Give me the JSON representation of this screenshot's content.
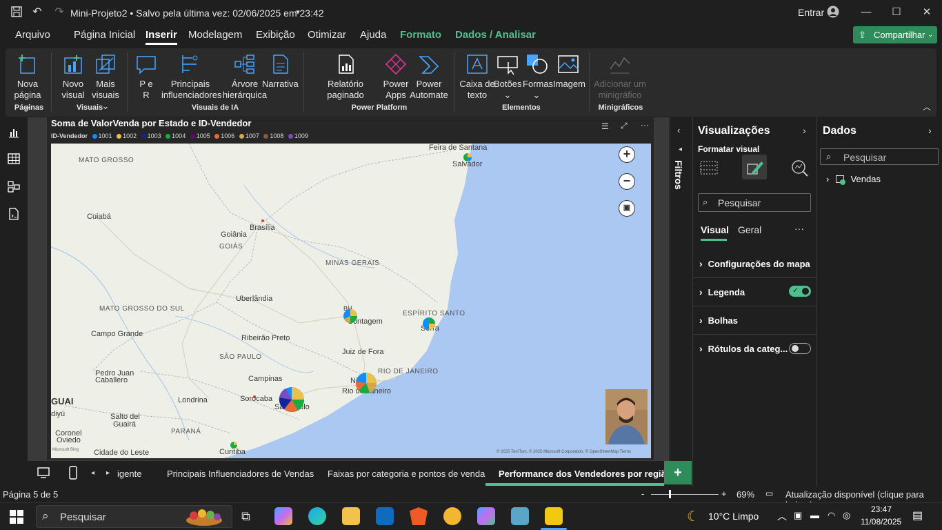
{
  "titlebar": {
    "doc_title": "Mini-Projeto2 • Salvo pela última vez: 02/06/2025 em 23:42",
    "signin": "Entrar"
  },
  "menu": {
    "items": [
      "Arquivo",
      "Página Inicial",
      "Inserir",
      "Modelagem",
      "Exibição",
      "Otimizar",
      "Ajuda",
      "Formato",
      "Dados / Analisar"
    ],
    "share": "Compartilhar"
  },
  "ribbon": {
    "new_page_1": "Nova",
    "new_page_2": "página ⌄",
    "new_visual_1": "Novo",
    "new_visual_2": "visual",
    "more_visuals_1": "Mais",
    "more_visuals_2": "visuais ⌄",
    "qa_1": "P e",
    "qa_2": "R",
    "influencers_1": "Principais",
    "influencers_2": "influenciadores",
    "tree_1": "Árvore",
    "tree_2": "hierárquica",
    "narrative": "Narrativa",
    "paginated": "Relatório paginado",
    "power_apps_1": "Power",
    "power_apps_2": "Apps",
    "power_automate_1": "Power",
    "power_automate_2": "Automate",
    "textbox_1": "Caixa de",
    "textbox_2": "texto",
    "buttons_1": "Botões",
    "buttons_2": "⌄",
    "shapes_1": "Formas",
    "shapes_2": "⌄",
    "image": "Imagem",
    "sparkline_1": "Adicionar um",
    "sparkline_2": "minigráfico",
    "groups": {
      "pages": "Páginas",
      "visuals": "Visuais",
      "ai_visuals": "Visuais de IA",
      "power_platform": "Power Platform",
      "elements": "Elementos",
      "sparklines": "Minigráficos"
    }
  },
  "visual": {
    "title": "Soma de ValorVenda por Estado e ID-Vendedor",
    "legend_title": "ID-Vendedor",
    "legend": [
      {
        "label": "1001",
        "color": "#118dff"
      },
      {
        "label": "1002",
        "color": "#e8c14e"
      },
      {
        "label": "1003",
        "color": "#12239e"
      },
      {
        "label": "1004",
        "color": "#1aab40"
      },
      {
        "label": "1005",
        "color": "#6b007b"
      },
      {
        "label": "1006",
        "color": "#e66c37"
      },
      {
        "label": "1007",
        "color": "#d6a64b"
      },
      {
        "label": "1008",
        "color": "#8a5a3c"
      },
      {
        "label": "1009",
        "color": "#744ec2"
      }
    ]
  },
  "map": {
    "places": {
      "feira": "Feira de Santana",
      "salvador": "Salvador",
      "mato_grosso": "MATO GROSSO",
      "cuiaba": "Cuiabá",
      "brasilia": "Brasília",
      "goiania": "Goiânia",
      "goias": "GOIÁS",
      "minas": "MINAS GERAIS",
      "uberlandia": "Uberlândia",
      "ms": "MATO GROSSO DO SUL",
      "bh": "BH",
      "contagem": "Contagem",
      "es": "ESPÍRITO SANTO",
      "serra": "Serra",
      "campo_grande": "Campo Grande",
      "ribeirao": "Ribeirão Preto",
      "sp_state": "SÃO PAULO",
      "juiz": "Juiz de Fora",
      "rj_state": "RIO DE JANEIRO",
      "pedro_juan": "Pedro Juan",
      "caballero": "Caballero",
      "campinas": "Campinas",
      "nit": "Niterói",
      "rio": "Rio de Janeiro",
      "guai": "GUAI",
      "londrina": "Londrina",
      "sorocaba": "Sorocaba",
      "saopaulo": "São Paulo",
      "diyu": "diyú",
      "salto": "Salto del",
      "guaira": "Guairá",
      "parana": "PARANÁ",
      "coronel": "Coronel",
      "oviedo": "Oviedo",
      "curitiba": "Curitiba",
      "cidade_leste": "Cidade do Leste",
      "bing": "Microsoft Bing"
    },
    "credit": "© 2025 TomTom, © 2025 Microsoft Corporation, © OpenStreetMap  Terms"
  },
  "filters": {
    "label": "Filtros"
  },
  "vispane": {
    "title": "Visualizações",
    "subtitle": "Formatar visual",
    "search_placeholder": "Pesquisar",
    "tab_visual": "Visual",
    "tab_geral": "Geral",
    "more": "···",
    "sections": [
      {
        "label": "Configurações do mapa"
      },
      {
        "label": "Legenda",
        "toggle": true
      },
      {
        "label": "Bolhas"
      },
      {
        "label": "Rótulos da categ...",
        "toggle": false
      }
    ]
  },
  "dados": {
    "title": "Dados",
    "search_placeholder": "Pesquisar",
    "table": "Vendas"
  },
  "pages": {
    "tabs": [
      "igente",
      "Principais Influenciadores de Vendas",
      "Faixas por categoria e pontos de venda",
      "Performance dos Vendedores por região"
    ],
    "active_index": 3
  },
  "status": {
    "page": "Página 5 de 5",
    "zoom": "69%",
    "update": "Atualização disponível (clique para baixar)"
  },
  "taskbar": {
    "search": "Pesquisar",
    "weather": "10°C  Limpo",
    "time": "23:47",
    "date": "11/08/2025"
  },
  "colors": {
    "accent_green": "#4fc08d",
    "share_green": "#2e8b5a",
    "ribbon_blue": "#4aa3ff"
  }
}
